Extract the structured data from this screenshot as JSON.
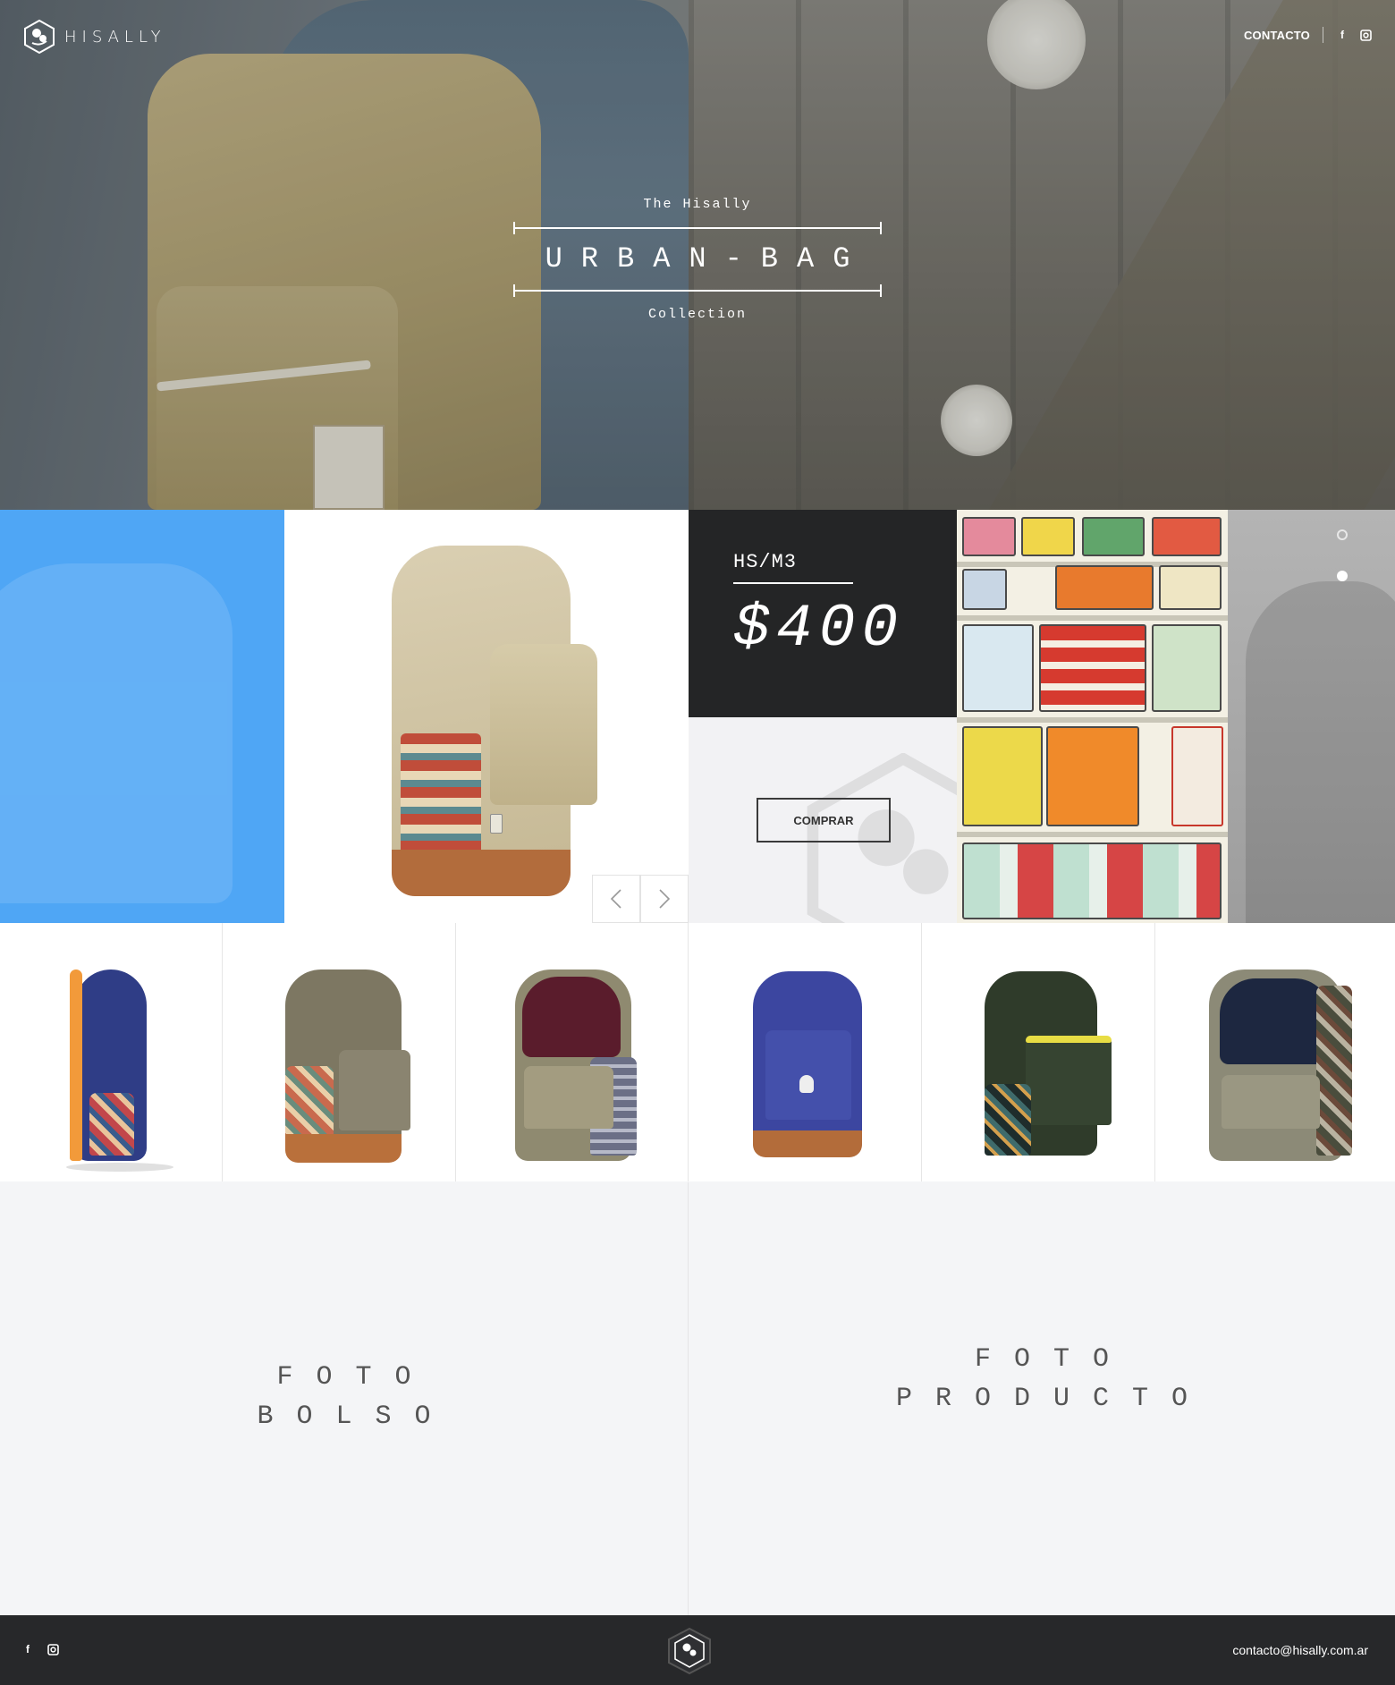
{
  "brand": {
    "name": "HISALLY",
    "logo_icon": "hisally-logo-icon"
  },
  "nav": {
    "contact_label": "CONTACTO",
    "social": [
      "facebook-icon",
      "instagram-icon"
    ]
  },
  "hero": {
    "pre": "The Hisally",
    "title": "URBAN-BAG",
    "post": "Collection"
  },
  "product": {
    "sku": "HS/M3",
    "price": "$400",
    "buy_label": "COMPRAR",
    "prev_icon": "chevron-left-icon",
    "next_icon": "chevron-right-icon",
    "slide_count": 2,
    "active_slide": 2
  },
  "thumbnails": [
    {
      "name": "navy-side",
      "color": "#2f3d86"
    },
    {
      "name": "olive-floral",
      "color": "#7d7762"
    },
    {
      "name": "khaki-open",
      "color": "#8f8a70"
    },
    {
      "name": "royal-blue",
      "color": "#3c46a0"
    },
    {
      "name": "forest-green",
      "color": "#2f3b2a"
    },
    {
      "name": "khaki-open-patterned",
      "color": "#8c8a77"
    }
  ],
  "placeholders": {
    "left": [
      "FOTO",
      "BOLSO"
    ],
    "right": [
      "FOTO",
      "PRODUCTO"
    ]
  },
  "footer": {
    "email": "contacto@hisally.com.ar",
    "social": [
      "facebook-icon",
      "instagram-icon"
    ]
  },
  "colors": {
    "accent_blue": "#4fa6f5",
    "dark": "#242526",
    "footer": "#27282a"
  }
}
